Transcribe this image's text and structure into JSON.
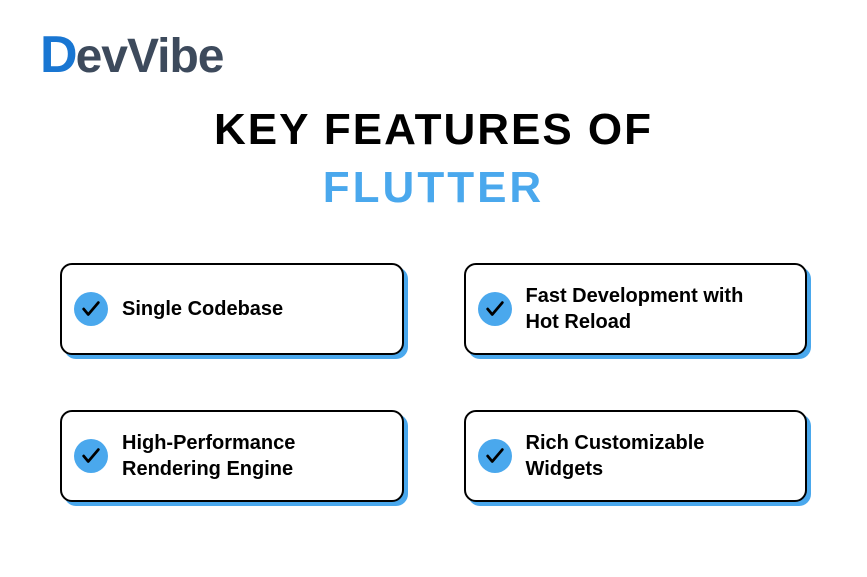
{
  "brand": {
    "logo_accent": "D",
    "logo_rest": "evVibe",
    "accent_color": "#1976d2",
    "text_color": "#3d4a5c"
  },
  "title": {
    "line1": "KEY FEATURES OF",
    "line2": "FLUTTER",
    "accent_color": "#4aa8ed"
  },
  "features": [
    {
      "label": "Single Codebase"
    },
    {
      "label": "Fast Development with Hot Reload"
    },
    {
      "label": "High-Performance Rendering Engine"
    },
    {
      "label": "Rich Customizable Widgets"
    }
  ],
  "card_shadow_color": "#4aa8ed"
}
